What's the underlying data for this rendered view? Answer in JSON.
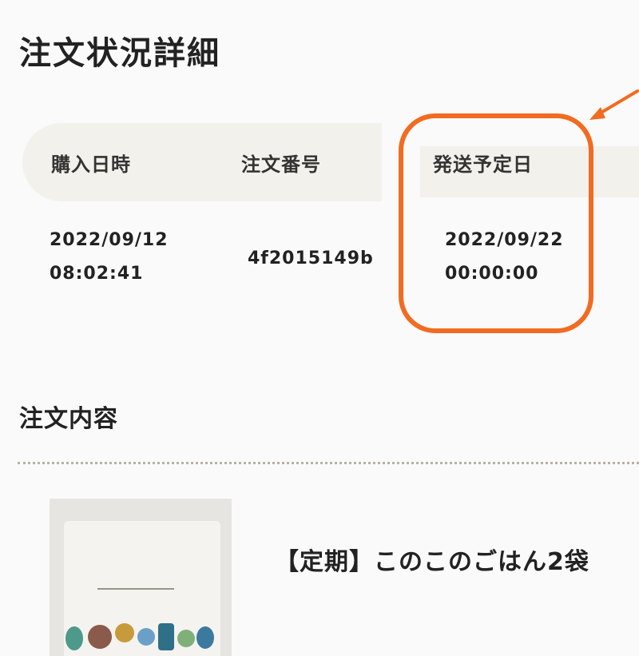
{
  "page": {
    "title": "注文状況詳細"
  },
  "order_table": {
    "headers": {
      "purchase_datetime": "購入日時",
      "order_number": "注文番号",
      "ship_date": "発送予定日"
    },
    "row": {
      "purchase_date": "2022/09/12",
      "purchase_time": "08:02:41",
      "order_number": "4f2015149b",
      "ship_date": "2022/09/22",
      "ship_time": "00:00:00"
    }
  },
  "order_contents": {
    "title": "注文内容",
    "product_name": "【定期】このこのごはん2袋"
  },
  "annotation": {
    "highlight_color": "#f26b21"
  }
}
